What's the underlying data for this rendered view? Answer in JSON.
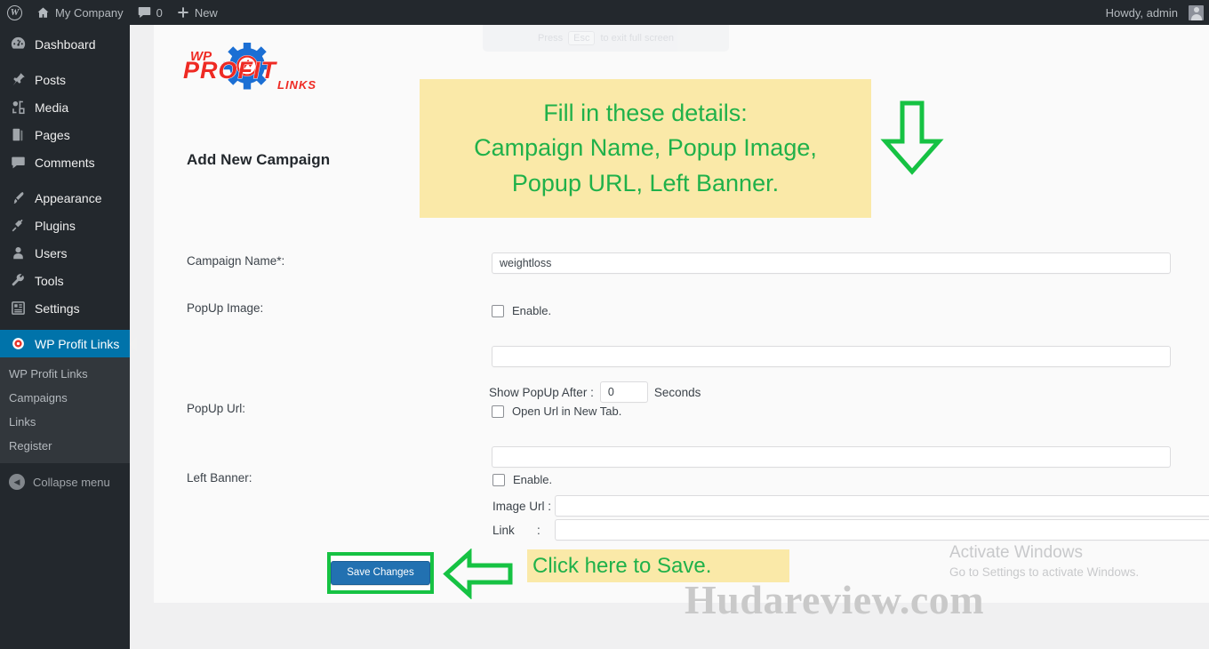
{
  "adminbar": {
    "wp_logo": "wordpress-logo-icon",
    "site_name": "My Company",
    "comments_count": "0",
    "new_label": "New",
    "howdy": "Howdy, admin"
  },
  "sidebar": {
    "items": [
      {
        "label": "Dashboard",
        "icon": "dashboard-icon",
        "current": false
      },
      {
        "label": "Posts",
        "icon": "pin-icon",
        "current": false
      },
      {
        "label": "Media",
        "icon": "media-icon",
        "current": false
      },
      {
        "label": "Pages",
        "icon": "page-icon",
        "current": false
      },
      {
        "label": "Comments",
        "icon": "comment-icon",
        "current": false
      },
      {
        "label": "Appearance",
        "icon": "brush-icon",
        "current": false
      },
      {
        "label": "Plugins",
        "icon": "plug-icon",
        "current": false
      },
      {
        "label": "Users",
        "icon": "user-icon",
        "current": false
      },
      {
        "label": "Tools",
        "icon": "wrench-icon",
        "current": false
      },
      {
        "label": "Settings",
        "icon": "settings-icon",
        "current": false
      },
      {
        "label": "WP Profit Links",
        "icon": "target-icon",
        "current": true
      }
    ],
    "submenu": [
      "WP Profit Links",
      "Campaigns",
      "Links",
      "Register"
    ],
    "collapse_label": "Collapse menu",
    "accent_color": "#0073aa"
  },
  "toast": {
    "prefix": "Press",
    "key": "Esc",
    "suffix": "to exit full screen"
  },
  "logo": {
    "wp": "WP",
    "profit": "PROFIT",
    "links": "LINKS",
    "red": "#ee2a23",
    "blue": "#1b6fd4"
  },
  "page": {
    "title": "Add New Campaign"
  },
  "form": {
    "campaign_name": {
      "label": "Campaign Name*:",
      "value": "weightloss",
      "placeholder": ""
    },
    "popup_image": {
      "label": "PopUp Image:",
      "enable_label": "Enable.",
      "enabled": false,
      "url_value": "",
      "delay_label": "Show PopUp After :",
      "delay_value": "0",
      "delay_units": "Seconds"
    },
    "popup_url": {
      "label": "PopUp Url:",
      "newtab_label": "Open Url in New Tab.",
      "newtab_checked": false,
      "url_value": ""
    },
    "left_banner": {
      "label": "Left Banner:",
      "enable_label": "Enable.",
      "enabled": false,
      "image_url_label": "Image Url :",
      "image_url_value": "",
      "link_label": "Link",
      "link_colon": ":",
      "link_value": ""
    },
    "save_button": "Save Changes"
  },
  "callouts": {
    "top": {
      "line1": "Fill in these details:",
      "line2": "Campaign Name, Popup Image,",
      "line3": "Popup URL, Left Banner.",
      "bg": "#fae9a8",
      "text_color": "#20b14a"
    },
    "save": {
      "text": "Click here to Save.",
      "bg": "#fae9a8",
      "text_color": "#20b14a"
    },
    "arrow_color": "#16c243"
  },
  "activate_windows": {
    "title": "Activate Windows",
    "subtitle": "Go to Settings to activate Windows."
  },
  "watermark": {
    "text": "Hudareview.com"
  }
}
